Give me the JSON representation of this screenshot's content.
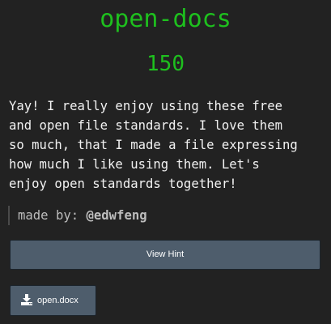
{
  "challenge": {
    "name": "open-docs",
    "points": "150",
    "description": "Yay! I really enjoy using these free\nand open file standards. I love them\nso much, that I made a file expressing\nhow much I like using them. Let's\nenjoy open standards together!",
    "author_prefix": "made by: ",
    "author_handle": "@edwfeng"
  },
  "buttons": {
    "hint_label": "View Hint",
    "file_label": "open.docx",
    "file_icon": "download-icon"
  },
  "colors": {
    "background": "#222222",
    "accent_green": "#1ec01e",
    "button": "#4e5d6c"
  }
}
